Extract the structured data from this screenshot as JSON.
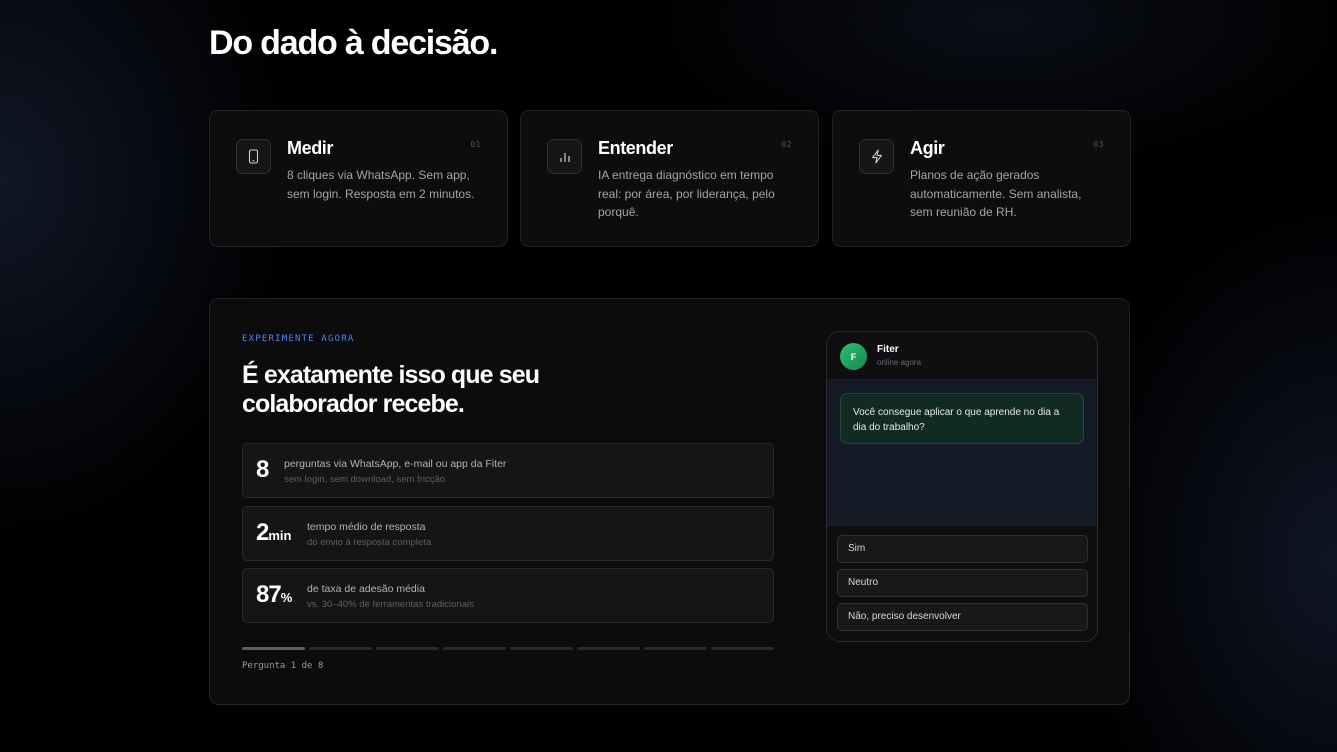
{
  "headline": "Do dado à decisão.",
  "steps": [
    {
      "icon": "smartphone-icon",
      "title": "Medir",
      "number": "01",
      "description": "8 cliques via WhatsApp. Sem app, sem login. Resposta em 2 minutos."
    },
    {
      "icon": "bar-chart-icon",
      "title": "Entender",
      "number": "02",
      "description": "IA entrega diagnóstico em tempo real: por área, por liderança, pelo porquê."
    },
    {
      "icon": "lightning-icon",
      "title": "Agir",
      "number": "03",
      "description": "Planos de ação gerados automaticamente. Sem analista, sem reunião de RH."
    }
  ],
  "demo": {
    "eyebrow": "EXPERIMENTE AGORA",
    "title": "É exatamente isso que seu colaborador recebe.",
    "stats": [
      {
        "value": "8",
        "unit": "",
        "label": "perguntas via WhatsApp, e-mail ou app da Fiter",
        "sublabel": "sem login, sem download, sem fricção"
      },
      {
        "value": "2",
        "unit": "min",
        "label": "tempo médio de resposta",
        "sublabel": "do envio à resposta completa"
      },
      {
        "value": "87",
        "unit": "%",
        "label": "de taxa de adesão média",
        "sublabel": "vs. 30–40% de ferramentas tradicionais"
      }
    ],
    "progress": {
      "current": 1,
      "total": 8,
      "label": "Pergunta 1 de 8"
    }
  },
  "chat": {
    "avatar_letter": "F",
    "contact_name": "Fiter",
    "contact_status": "online agora",
    "question": "Você consegue aplicar o que aprende no dia a dia do trabalho?",
    "answers": [
      "Sim",
      "Neutro",
      "Não, preciso desenvolver"
    ]
  },
  "colors": {
    "accent": "#4f84f0",
    "whatsapp_green": "#2bbf72",
    "bubble_bg": "#112a22",
    "background": "#000000"
  }
}
